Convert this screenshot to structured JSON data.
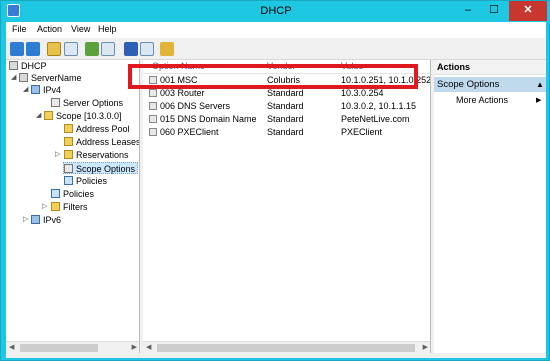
{
  "window": {
    "title": "DHCP",
    "controls": {
      "minimize": "–",
      "maximize": "☐",
      "close": "✕"
    }
  },
  "menu": [
    "File",
    "Action",
    "View",
    "Help"
  ],
  "toolbar": [
    "back-icon",
    "forward-icon",
    "up-folder-icon",
    "show-hide-tree-icon",
    "refresh-icon",
    "export-icon",
    "help-icon",
    "properties-icon",
    "configure-options-icon"
  ],
  "tree": {
    "root": "DHCP",
    "server": "ServerName",
    "ipv4": "IPv4",
    "server_options": "Server Options",
    "scope": "Scope [10.3.0.0]",
    "address_pool": "Address Pool",
    "address_leases": "Address Leases",
    "reservations": "Reservations",
    "scope_options": "Scope Options",
    "scope_policies": "Policies",
    "policies": "Policies",
    "filters": "Filters",
    "ipv6": "IPv6"
  },
  "list": {
    "columns": {
      "name": "Option Name",
      "vendor": "Vendor",
      "value": "Value"
    },
    "rows": [
      {
        "name": "001 MSC",
        "vendor": "Colubris",
        "value": "10.1.0.251, 10.1.0.252"
      },
      {
        "name": "003 Router",
        "vendor": "Standard",
        "value": "10.3.0.254"
      },
      {
        "name": "006 DNS Servers",
        "vendor": "Standard",
        "value": "10.3.0.2, 10.1.1.15"
      },
      {
        "name": "015 DNS Domain Name",
        "vendor": "Standard",
        "value": "PeteNetLive.com"
      },
      {
        "name": "060 PXEClient",
        "vendor": "Standard",
        "value": "PXEClient"
      }
    ]
  },
  "actions": {
    "header": "Actions",
    "section": "Scope Options",
    "more": "More Actions"
  },
  "colors": {
    "title_bar": "#1ec8e2",
    "close_button": "#c7372f",
    "highlight_box": "#e0191e",
    "selection": "#cce8ff",
    "actions_section": "#bfd9ed"
  }
}
